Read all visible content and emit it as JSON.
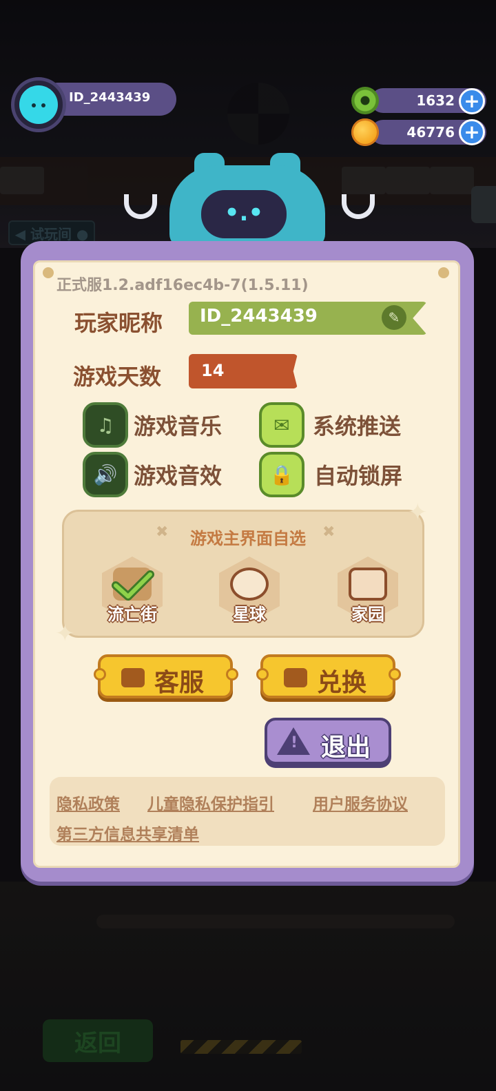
{
  "hud": {
    "player_id": "ID_2443439",
    "currencies": [
      {
        "icon": "donut-icon",
        "value": "1632"
      },
      {
        "icon": "planet-icon",
        "value": "46776"
      }
    ],
    "plus_symbol": "+"
  },
  "robot": {
    "face": "•.•"
  },
  "background": {
    "return_label": "返回",
    "trial_label": "◀ 试玩间 ●"
  },
  "settings": {
    "version": "正式服1.2.adf16ec4b-7(1.5.11)",
    "nickname_label": "玩家昵称",
    "nickname_value": "ID_2443439",
    "days_label": "游戏天数",
    "days_value": "14",
    "toggles": [
      {
        "label": "游戏音乐",
        "icon": "music-note-icon",
        "state": "off"
      },
      {
        "label": "系统推送",
        "icon": "envelope-icon",
        "state": "on"
      },
      {
        "label": "游戏音效",
        "icon": "speaker-icon",
        "state": "off"
      },
      {
        "label": "自动锁屏",
        "icon": "lock-icon",
        "state": "on"
      }
    ],
    "main_ui": {
      "title": "游戏主界面自选",
      "options": [
        {
          "label": "流亡街",
          "selected": true
        },
        {
          "label": "星球",
          "selected": false
        },
        {
          "label": "家园",
          "selected": false
        }
      ]
    },
    "buttons": {
      "support": "客服",
      "redeem": "兑换",
      "exit": "退出"
    },
    "links": [
      "隐私政策",
      "儿童隐私保护指引",
      "用户服务协议",
      "第三方信息共享清单"
    ]
  },
  "colors": {
    "panel_purple": "#a58ccc",
    "paper": "#fbf1da",
    "label_brown": "#8a5030",
    "nickname_green": "#97b24f",
    "days_orange": "#c0552c",
    "button_gold": "#f6c62e"
  }
}
